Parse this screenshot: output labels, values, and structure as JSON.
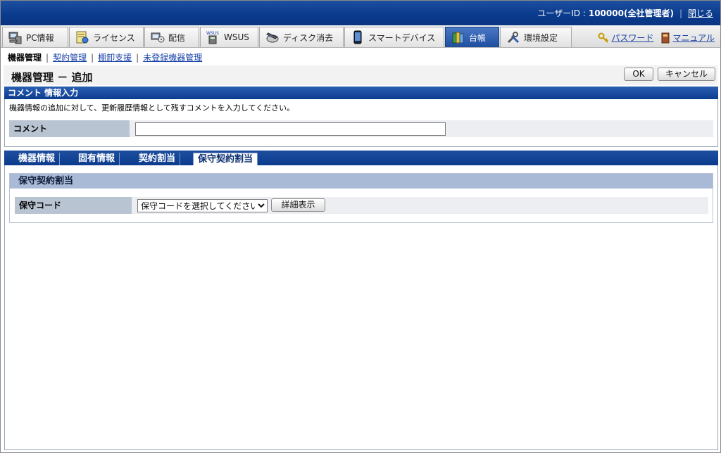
{
  "header": {
    "user_label": "ユーザーID : ",
    "user_value": "100000(全社管理者)",
    "close_link": "閉じる"
  },
  "main_tabs": [
    {
      "label": "PC情報",
      "icon": "pc-info-icon"
    },
    {
      "label": "ライセンス",
      "icon": "license-icon"
    },
    {
      "label": "配信",
      "icon": "distribution-icon"
    },
    {
      "label": "WSUS",
      "icon": "wsus-icon"
    },
    {
      "label": "ディスク消去",
      "icon": "disk-erase-icon"
    },
    {
      "label": "スマートデバイス",
      "icon": "smart-device-icon"
    },
    {
      "label": "台帳",
      "icon": "ledger-icon",
      "active": true
    },
    {
      "label": "環境設定",
      "icon": "settings-tools-icon"
    }
  ],
  "utility_links": {
    "password": "パスワード",
    "manual": "マニュアル"
  },
  "subnav": {
    "current": "機器管理",
    "items": [
      "契約管理",
      "棚卸支援",
      "未登録機器管理"
    ]
  },
  "page": {
    "title": "機器管理 － 追加",
    "ok_button": "OK",
    "cancel_button": "キャンセル"
  },
  "comment_section": {
    "header": "コメント 情報入力",
    "description": "機器情報の追加に対して、更新履歴情報として残すコメントを入力してください。",
    "comment_label": "コメント",
    "comment_value": ""
  },
  "sub_tabs": [
    {
      "label": "機器情報"
    },
    {
      "label": "固有情報"
    },
    {
      "label": "契約割当"
    },
    {
      "label": "保守契約割当",
      "active": true
    }
  ],
  "maintenance": {
    "header": "保守契約割当",
    "code_label": "保守コード",
    "select_value": "保守コードを選択してください",
    "detail_button": "詳細表示"
  },
  "colors": {
    "header_blue": "#0b3b8d",
    "active_tab": "#1e4e9e",
    "link": "#1b43a8",
    "label_bg": "#b9c4d3"
  }
}
